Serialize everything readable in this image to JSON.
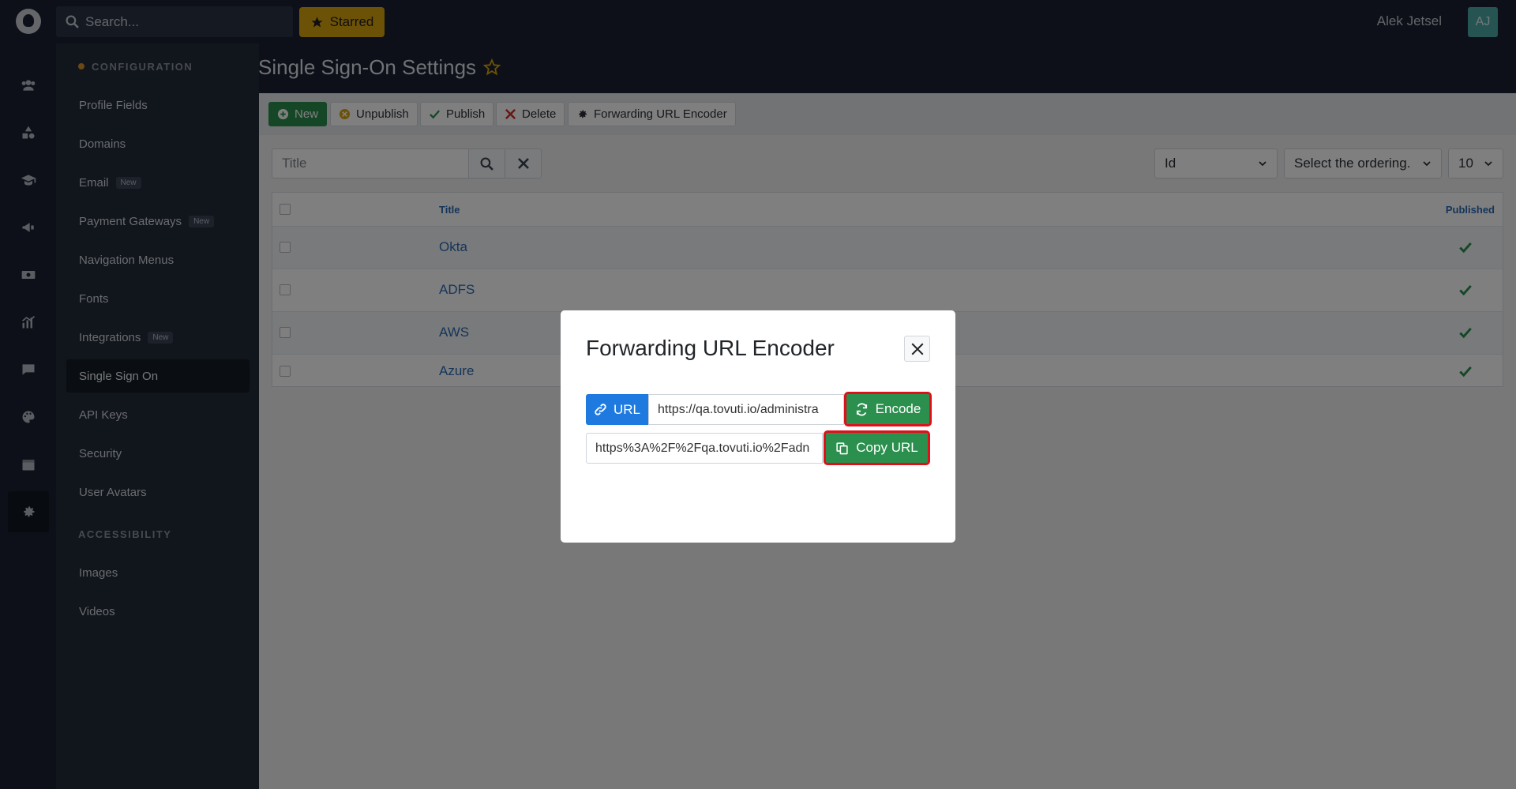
{
  "topbar": {
    "search_placeholder": "Search...",
    "starred_label": "Starred",
    "user_name": "Alek Jetsel",
    "user_initials": "AJ"
  },
  "rail": {
    "icons": [
      "users-icon",
      "shapes-icon",
      "graduation-cap-icon",
      "megaphone-icon",
      "money-icon",
      "chart-icon",
      "chat-icon",
      "palette-icon",
      "calendar-icon",
      "gear-icon"
    ],
    "active": "gear-icon"
  },
  "sidebar": {
    "section1": "CONFIGURATION",
    "section2": "ACCESSIBILITY",
    "new_badge": "New",
    "items": [
      {
        "label": "Profile Fields"
      },
      {
        "label": "Domains"
      },
      {
        "label": "Email",
        "badge": "New"
      },
      {
        "label": "Payment Gateways",
        "badge": "New"
      },
      {
        "label": "Navigation Menus"
      },
      {
        "label": "Fonts"
      },
      {
        "label": "Integrations",
        "badge": "New"
      },
      {
        "label": "Single Sign On"
      },
      {
        "label": "API Keys"
      },
      {
        "label": "Security"
      },
      {
        "label": "User Avatars"
      }
    ],
    "items2": [
      {
        "label": "Images"
      },
      {
        "label": "Videos"
      }
    ],
    "active_item": "Single Sign On"
  },
  "main": {
    "page_title": "Single Sign-On Settings",
    "toolbar": {
      "new": "New",
      "unpublish": "Unpublish",
      "publish": "Publish",
      "delete": "Delete",
      "forwarding": "Forwarding URL Encoder"
    },
    "filter": {
      "title_placeholder": "Title",
      "sort_field": "Id",
      "ordering": "Select the ordering.",
      "limit": "10"
    },
    "table": {
      "col_title": "Title",
      "col_published": "Published",
      "rows": [
        {
          "title": "Okta",
          "published": true
        },
        {
          "title": "ADFS",
          "published": true
        },
        {
          "title": "AWS",
          "published": true
        },
        {
          "title": "Azure",
          "published": true
        }
      ]
    }
  },
  "modal": {
    "title": "Forwarding URL Encoder",
    "url_label": "URL",
    "url_value": "https://qa.tovuti.io/administra",
    "encode_label": "Encode",
    "encoded_value": "https%3A%2F%2Fqa.tovuti.io%2Fadn",
    "copy_label": "Copy URL"
  },
  "colors": {
    "accent_green": "#2b8f4e",
    "highlight_red": "#e0101a",
    "url_blue": "#1f7ae0",
    "starred_yellow": "#d9a40f"
  }
}
